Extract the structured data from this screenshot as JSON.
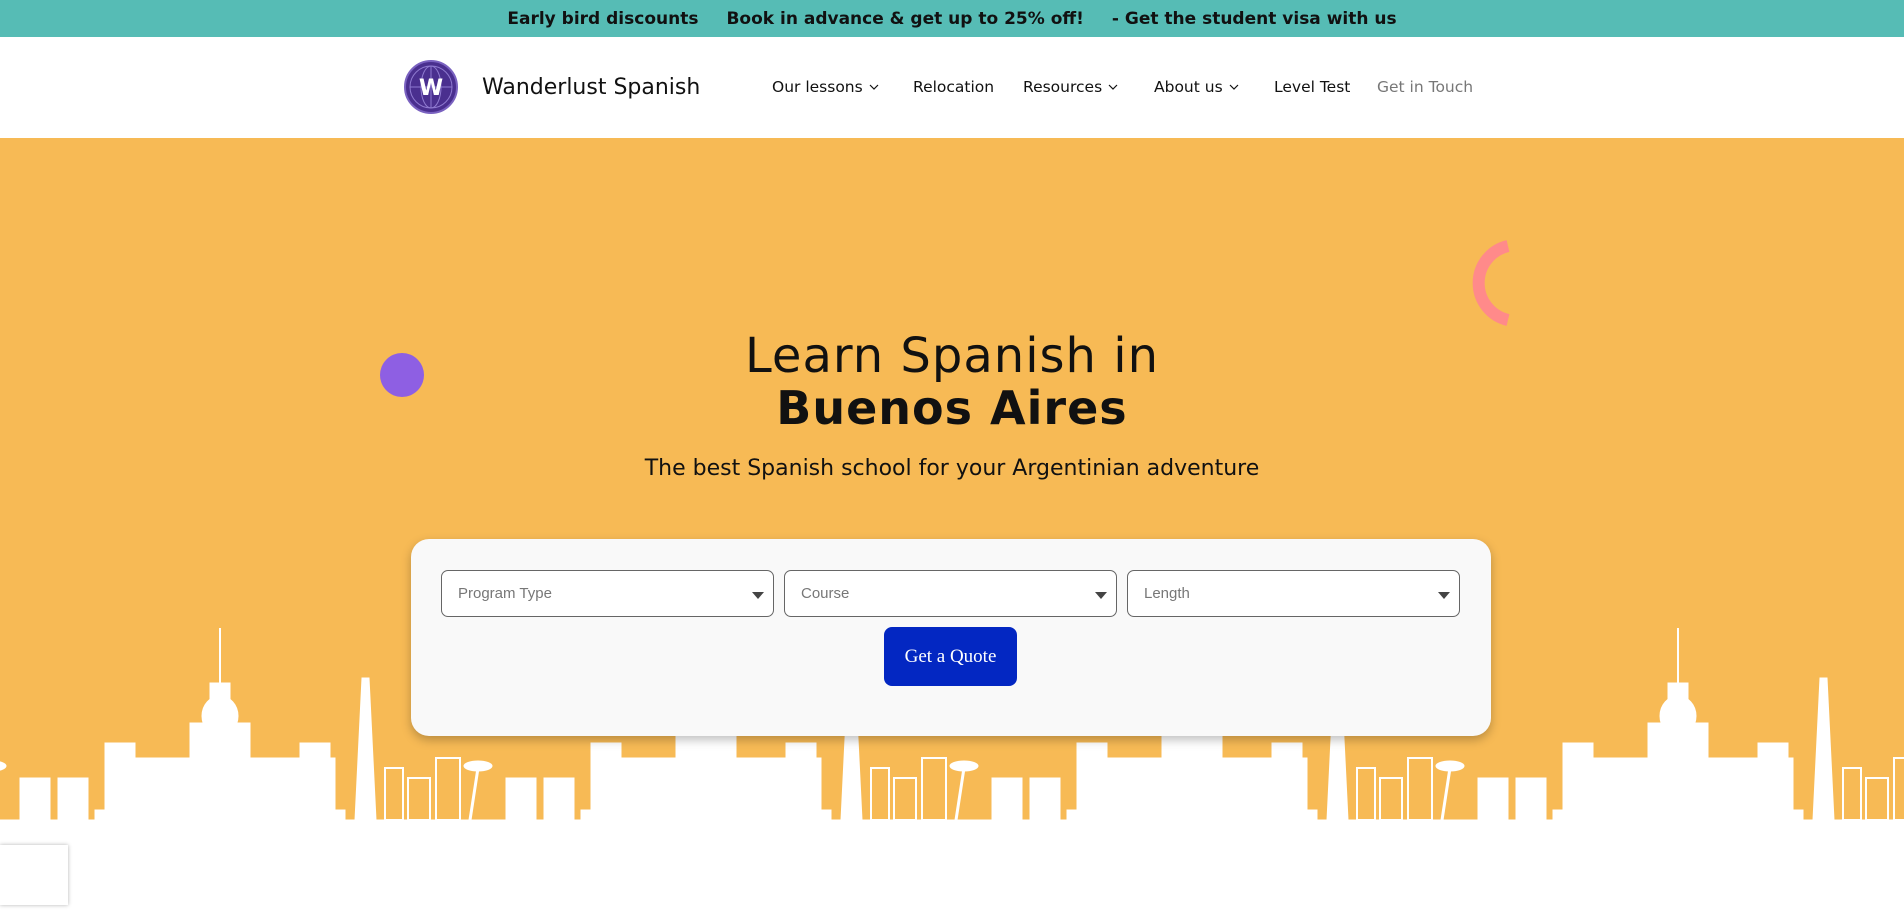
{
  "topbar": {
    "messages": [
      "Early bird discounts",
      "Book in advance & get up to 25% off!",
      "- Get the student visa with us"
    ],
    "background": "#56bcb5"
  },
  "header": {
    "logo_letter": "W",
    "brand_name": "Wanderlust Spanish",
    "nav": [
      {
        "label": "Our lessons",
        "has_dropdown": true
      },
      {
        "label": "Relocation",
        "has_dropdown": false
      },
      {
        "label": "Resources",
        "has_dropdown": true
      },
      {
        "label": "About us",
        "has_dropdown": true
      },
      {
        "label": "Level Test",
        "has_dropdown": false
      },
      {
        "label": "Get in Touch",
        "has_dropdown": false
      }
    ]
  },
  "hero": {
    "title_line1": "Learn Spanish in",
    "title_line2": "Buenos Aires",
    "subtitle": "The best Spanish school for your Argentinian adventure",
    "background": "#f7ba55"
  },
  "quote_form": {
    "program_type_placeholder": "Program Type",
    "course_placeholder": "Course",
    "length_placeholder": "Length",
    "submit_label": "Get a Quote",
    "button_color": "#0327c2"
  },
  "icons": {
    "logo": "globe-w-logo-icon",
    "dropdown": "chevron-down-icon",
    "select_caret": "caret-down-icon"
  }
}
